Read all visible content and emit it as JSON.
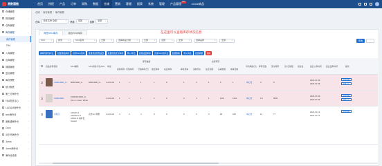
{
  "brand": {
    "name": "易数通链",
    "accent": "#1f4e8c",
    "highlight": "#e23b3b"
  },
  "nav": {
    "items": [
      "首页",
      "授权",
      "产品",
      "订单",
      "采购",
      "数据",
      "仓储",
      "营销",
      "客服",
      "报表",
      "系统",
      "管理",
      "产品管理",
      "Clone商品"
    ],
    "active_index": 6,
    "badge": "NEW"
  },
  "sidebar": {
    "items": [
      {
        "label": "仓储管理",
        "icon": "warehouse-icon"
      },
      {
        "label": "物流管理",
        "icon": "truck-icon"
      },
      {
        "label": "仓库管理",
        "icon": "box-icon"
      },
      {
        "label": "库存管理",
        "icon": "stock-icon",
        "open": true
      }
    ],
    "subitems": [
      "库存管理",
      "FBA"
    ],
    "more": [
      "入库管理",
      "出库管理",
      "调拨管理",
      "盘点管理",
      "库存预警",
      "统计报表",
      "第三方海外仓",
      "FBA配送中心",
      "LAZADA海外仓",
      "web海外仓",
      "速卖通海外仓",
      "Ozon",
      "沃尔玛海外仓",
      "Jumia",
      "Jumia海外仓",
      "海外仓设置"
    ]
  },
  "breadcrumb": [
    "仓储",
    "库存管理",
    "库存管理"
  ],
  "filters": {
    "labels": [
      "仓库",
      "筛选",
      "品牌"
    ],
    "warehouse": "仓库名称 全部",
    "type": "全部",
    "brand": "全部"
  },
  "tabs": [
    "商品SKU库存",
    "组合SKU库存"
  ],
  "active_tab": 0,
  "notice": "在这里可以查看库存状况信息",
  "search_filters": [
    "SKU",
    "搜索",
    "SKU名称",
    "全部",
    "选择商品分类",
    "全部",
    "全部",
    "全部",
    "选择品牌",
    "全部"
  ],
  "buttons": {
    "query": "查询",
    "actions": [
      "库存同步到平台",
      "批量修改库存",
      "打印SKU条码",
      "批量修改预警设置",
      "批量修改安全库存",
      "导入/导出",
      "批量设置库存",
      "同步SKU到平台",
      "批量删除",
      "导入列表",
      "批量调整",
      "删除"
    ]
  },
  "table": {
    "headers": {
      "image": "商品名称/图片",
      "sku": "SKU编码",
      "sku_alias": "SKU别名/平台SKU",
      "unit": "单位",
      "stock_group": "库存数量",
      "stock_sub": [
        "实际库存",
        "可用库存",
        "可用库存(仓)",
        "锁定库存",
        "在途库存"
      ],
      "cost_group": "仓库库存",
      "cost_sub": [
        "库存成本",
        "采购均价",
        "在途金额",
        "头程费用",
        "成本金额"
      ],
      "avg": "平均库龄(天)",
      "days": "库存天数",
      "safety": "安全库存",
      "sales": "近7日销量",
      "shelf": "货架位",
      "last_in": "最近入库时间",
      "last_out": "最近出库时间",
      "op": "操作"
    },
    "rows": [
      {
        "name": "SHIRI-RED_G..",
        "sku": "0000-RED_G..",
        "alias": "0000-RED_G..",
        "unit": "1-2-01-01",
        "nums": [
          "1",
          "1",
          "1",
          "1",
          "0",
          "1",
          "1",
          "1"
        ],
        "cost": "2",
        "qty": "1",
        "tag": "中心仓",
        "rate": "4",
        "pct": "0",
        "date1": "2020-07-09",
        "date2": "2020-07-09",
        "ops": [
          "查看明细",
          "查看日志"
        ],
        "thumb": "#7a5a48",
        "highlight": true
      },
      {
        "name": "SHIRI-RED..",
        "sku": "100001R-RED_S..",
        "alias": "SGn: 1 Color: White",
        "unit": "1-2-01-01",
        "nums": [
          "1",
          "1",
          "1",
          "2",
          "0",
          "3",
          "1",
          "1"
        ],
        "cost": "1212",
        "qty": "1212",
        "tag": "中心仓",
        "rate": "9.1",
        "pct": "8000",
        "date1": "2020-07-09",
        "date2": "2020-07-09",
        "ops": [
          "查看明细",
          "查看日志"
        ],
        "thumb": "#d9d2cc",
        "highlight": true
      },
      {
        "name": "手机壳",
        "sku": "A10231-0 A10010 C-5 A0510-D 海外仓 Scarlet",
        "alias": "高仿 DJ 苹果",
        "unit": "1-2-01-01",
        "nums": [
          "4",
          "4",
          "4",
          "0",
          "0",
          "0",
          "0",
          "0"
        ],
        "cost": "80",
        "qty": "180",
        "tag": "中心仓",
        "rate": "12",
        "pct": "77",
        "date1": "2021-11-13",
        "date2": "2021-11-13",
        "ops": [
          "查看明细"
        ],
        "thumb": "#3b6fbf",
        "highlight": false
      }
    ]
  }
}
